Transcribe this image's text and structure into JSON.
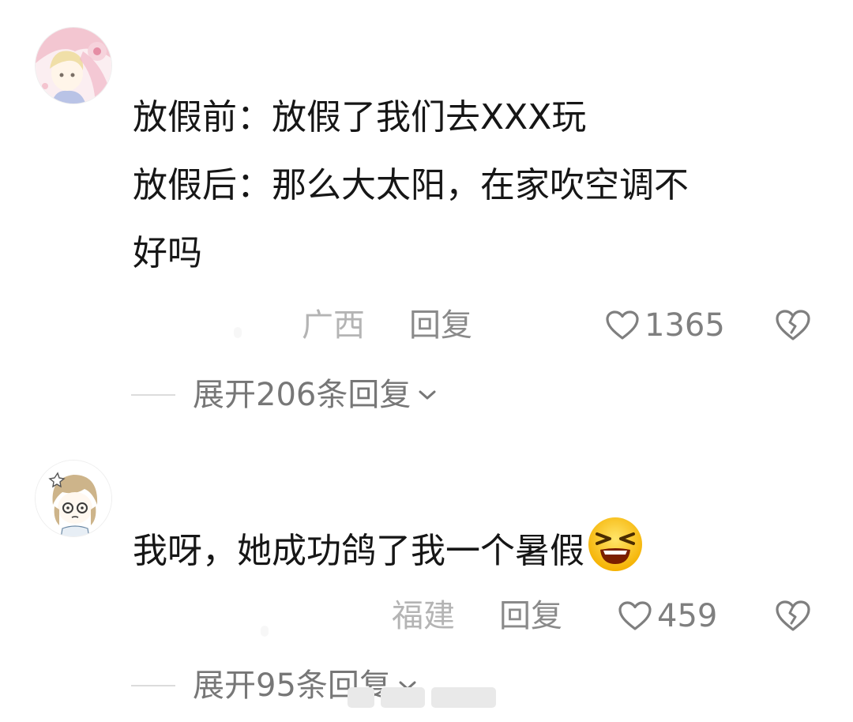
{
  "comments": [
    {
      "avatar_icon": "anime-girl-pink-avatar",
      "text_lines": [
        "放假前：放假了我们去XXX玩",
        "放假后：那么大太阳，在家吹空调不",
        "好吗"
      ],
      "location": "广西",
      "reply_label": "回复",
      "like_count": "1365",
      "expand_label": "展开206条回复"
    },
    {
      "avatar_icon": "anime-chibi-avatar",
      "text": "我呀，她成功鸽了我一个暑假",
      "emoji": "angry-grin-emoji",
      "location": "福建",
      "reply_label": "回复",
      "like_count": "459",
      "expand_label": "展开95条回复"
    }
  ],
  "icons": {
    "like": "heart-outline-icon",
    "dislike": "broken-heart-icon",
    "expand": "chevron-down-icon"
  },
  "colors": {
    "text": "#161616",
    "location": "#b4b4b4",
    "reply": "#8a8a8a",
    "count": "#7f7f7f",
    "expand": "#777777"
  }
}
